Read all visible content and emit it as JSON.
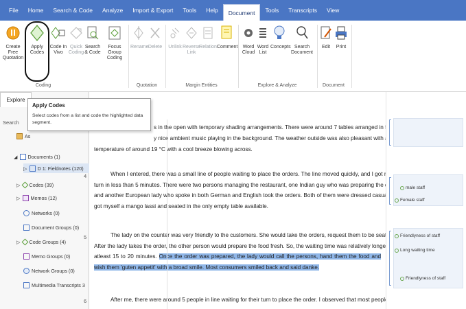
{
  "menubar": {
    "items": [
      "File",
      "Home",
      "Search & Code",
      "Analyze",
      "Import & Export",
      "Tools",
      "Help",
      "Document",
      "Tools",
      "Transcripts",
      "View"
    ],
    "active_index": 7,
    "color": "#4a76c4"
  },
  "ribbon": {
    "buttons": [
      {
        "label": "Create Free Quotation",
        "icon": "create-quotation-icon"
      },
      {
        "label": "Apply Codes",
        "icon": "apply-codes-icon"
      },
      {
        "label": "Code In Vivo",
        "icon": "code-in-vivo-icon"
      },
      {
        "label": "Quick Coding",
        "icon": "quick-coding-icon"
      },
      {
        "label": "Search & Code",
        "icon": "search-code-icon"
      },
      {
        "label": "Focus Group Coding",
        "icon": "focus-group-icon"
      },
      {
        "label": "Rename",
        "icon": "rename-icon"
      },
      {
        "label": "Delete",
        "icon": "delete-icon"
      },
      {
        "label": "Unlink",
        "icon": "unlink-icon"
      },
      {
        "label": "Reverse Link",
        "icon": "reverse-link-icon"
      },
      {
        "label": "Relation",
        "icon": "relation-icon"
      },
      {
        "label": "Comment",
        "icon": "comment-icon"
      },
      {
        "label": "Word Cloud",
        "icon": "word-cloud-icon"
      },
      {
        "label": "Word List",
        "icon": "word-list-icon"
      },
      {
        "label": "Concepts",
        "icon": "concepts-icon"
      },
      {
        "label": "Search Document",
        "icon": "search-document-icon"
      },
      {
        "label": "Edit",
        "icon": "edit-icon"
      },
      {
        "label": "Print",
        "icon": "print-icon"
      }
    ],
    "groups": [
      "Coding",
      "Quotation",
      "Margin Entities",
      "Explore & Analyze",
      "Document"
    ]
  },
  "explore": {
    "tab": "Explore",
    "search": "Search",
    "items": [
      {
        "label": "As"
      },
      {
        "label": "Documents (1)"
      },
      {
        "label": "D 1: Fieldnotes (120)"
      },
      {
        "label": "Codes (39)"
      },
      {
        "label": "Memos (12)"
      },
      {
        "label": "Networks (0)"
      },
      {
        "label": "Document Groups (0)"
      },
      {
        "label": "Code Groups (4)"
      },
      {
        "label": "Memo Groups (0)"
      },
      {
        "label": "Network Groups (0)"
      },
      {
        "label": "Multimedia Transcripts 3"
      }
    ]
  },
  "tooltip": {
    "title": "Apply Codes",
    "description_line1": "Select codes from a list and code the highlighted data",
    "description_line2": "segment."
  },
  "document": {
    "paragraphs": [
      {
        "num": "",
        "lines": [
          "s in the open with temporary shading arrangements. There were around 7 tables arranged in front",
          "y nice ambient music playing in the background. The weather outside was also pleasant with a",
          "temperature of around 19 °C with a cool breeze blowing across."
        ]
      },
      {
        "num": "4",
        "lines": [
          "When I entered, there was a small line of people waiting to place the orders. The line moved quickly, and I got my",
          "turn in less than 5 minutes. There were two persons managing the restaurant, one Indian guy who was preparing the dishes",
          "and another European lady who spoke in both German and English took the orders. Both of them were dressed casually. I",
          "got myself a mango lassi and seated in the only empty table available."
        ]
      },
      {
        "num": "5",
        "lines_before_hl": [
          "The lady on the counter was very friendly to the customers. She would take the orders, request them to be seated.",
          "After the lady takes the order, the other person would prepare the food fresh. So, the waiting time was relatively longer,",
          "atleast 15 to 20 minutes. "
        ],
        "highlight": "Once the order was prepared, the lady would call the persons, hand them the food and wish them 'guten appetit' with a broad smile. Most consumers smiled back and said danke."
      },
      {
        "num": "6",
        "lines": [
          "After me, there were around 5 people in line waiting for their turn to place the order. I observed that most people in"
        ]
      }
    ]
  },
  "margin": {
    "codes": [
      "male staff",
      "Female staff",
      "Friendlyness of staff",
      "Long waiting time",
      "Friendlyness of staff"
    ],
    "code_color": "#6aa84f"
  }
}
